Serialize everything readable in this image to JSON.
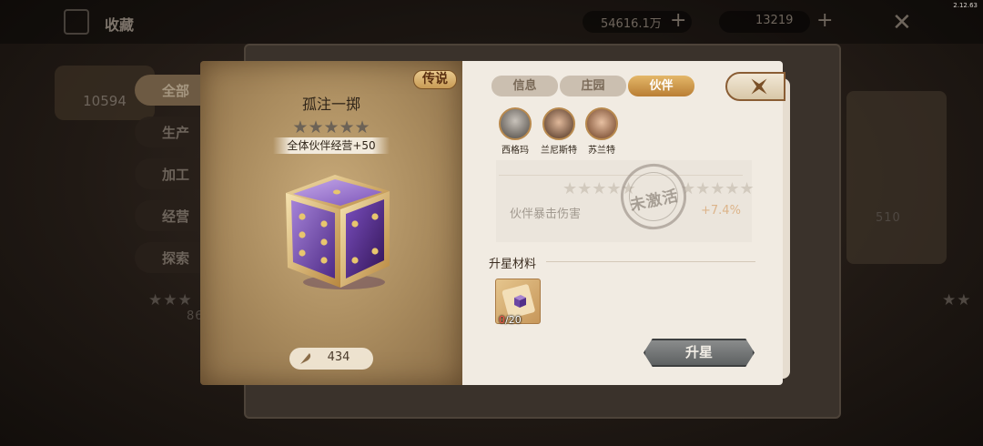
{
  "version": "2.12.63",
  "background": {
    "title": "收藏",
    "resource1": "54616.1万",
    "resource2": "13219",
    "score": "10594",
    "tabs": [
      "全部",
      "生产",
      "加工",
      "经营",
      "探索"
    ],
    "card_value": "510",
    "card_value2": "86"
  },
  "item": {
    "rarity": "传说",
    "name": "孤注一掷",
    "stars": "★★★★★",
    "effect": "全体伙伴经营+50",
    "owned_count": "434"
  },
  "tabs": [
    {
      "label": "信息",
      "active": false
    },
    {
      "label": "庄园",
      "active": false
    },
    {
      "label": "伙伴",
      "active": true
    }
  ],
  "partners": [
    {
      "name": "西格玛"
    },
    {
      "name": "兰尼斯特"
    },
    {
      "name": "苏兰特"
    }
  ],
  "bonus": {
    "stars_left": "★★★★★",
    "stars_right": "★★★★★",
    "label": "伙伴暴击伤害",
    "value": "+7.4%",
    "status_seal": "未激活"
  },
  "materials": {
    "title": "升星材料",
    "have": "0",
    "need": "20"
  },
  "upgrade_label": "升星",
  "colors": {
    "accent_gold": "#c89b55",
    "active_tab": "#d29a4c",
    "dice_purple": "#6b3fa8"
  }
}
